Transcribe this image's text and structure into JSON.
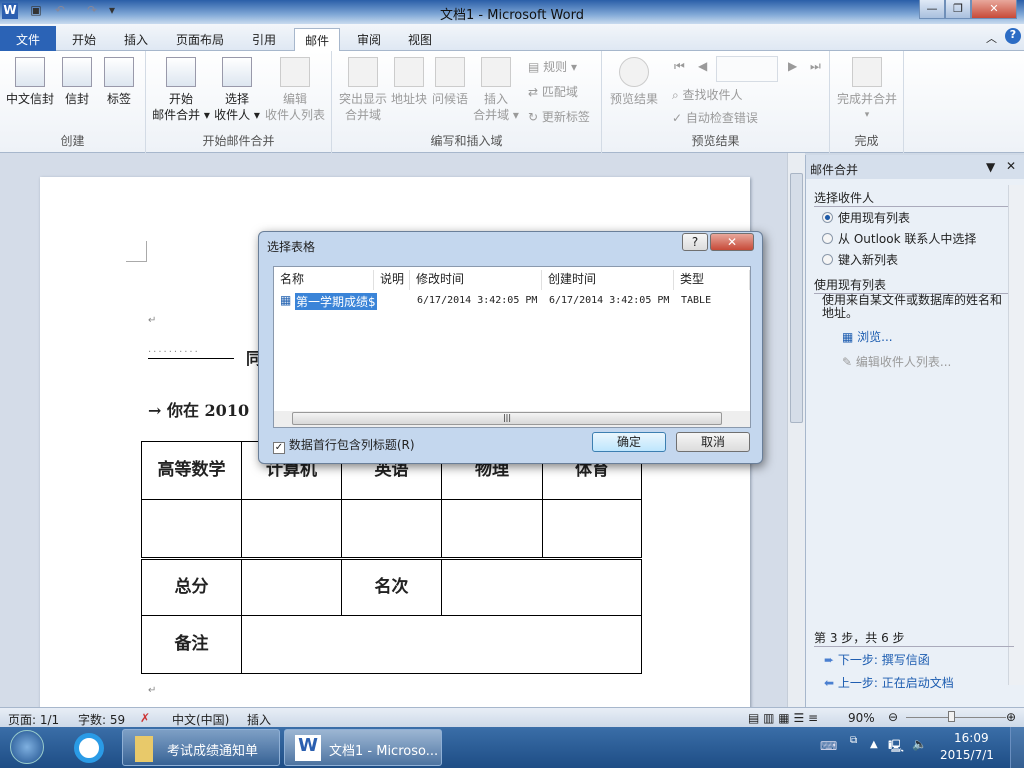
{
  "window": {
    "title": "文档1 - Microsoft Word",
    "controls": [
      "—",
      "❐",
      "✕"
    ]
  },
  "tabs": [
    "文件",
    "开始",
    "插入",
    "页面布局",
    "引用",
    "邮件",
    "审阅",
    "视图"
  ],
  "ribbon": {
    "create": {
      "label": "创建",
      "buttons": [
        "中文信封",
        "信封",
        "标签"
      ]
    },
    "start": {
      "label": "开始邮件合并",
      "b1": [
        "开始",
        "邮件合并 ▾"
      ],
      "b2": [
        "选择",
        "收件人 ▾"
      ],
      "b3": [
        "编辑",
        "收件人列表"
      ]
    },
    "write": {
      "label": "编写和插入域",
      "b1": [
        "突出显示",
        "合并域"
      ],
      "b2": "地址块",
      "b3": "问候语",
      "b4": [
        "插入",
        "合并域 ▾"
      ],
      "small": [
        "规则 ▾",
        "匹配域",
        "更新标签"
      ]
    },
    "preview": {
      "label": "预览结果",
      "big": "预览结果",
      "small": [
        "查找收件人",
        "自动检查错误"
      ]
    },
    "finish": {
      "label": "完成",
      "big": "完成并合并",
      "arrow": "▾"
    }
  },
  "document": {
    "line1": "同",
    "line2": "→ 你在 2010",
    "headers": [
      "高等数学",
      "计算机",
      "英语",
      "物理",
      "体育"
    ],
    "total": "总分",
    "rank": "名次",
    "note": "备注",
    "para": "↵"
  },
  "dialog": {
    "title": "选择表格",
    "help": "?",
    "close": "✕",
    "columns": [
      "名称",
      "说明",
      "修改时间",
      "创建时间",
      "类型"
    ],
    "rows": [
      {
        "name": "第一学期成绩$",
        "desc": "",
        "modified": "6/17/2014 3:42:05 PM",
        "created": "6/17/2014 3:42:05 PM",
        "type": "TABLE"
      }
    ],
    "checkbox": "数据首行包含列标题(R)",
    "checked": true,
    "ok": "确定",
    "cancel": "取消"
  },
  "pane": {
    "title": "邮件合并",
    "section1": "选择收件人",
    "options": [
      "使用现有列表",
      "从 Outlook 联系人中选择",
      "键入新列表"
    ],
    "selected": 0,
    "section2": "使用现有列表",
    "desc": "使用来自某文件或数据库的姓名和地址。",
    "browse": "浏览...",
    "edit": "编辑收件人列表...",
    "step": "第 3 步，共 6 步",
    "next": "下一步: 撰写信函",
    "prev": "上一步: 正在启动文档"
  },
  "status": {
    "page": "页面: 1/1",
    "words": "字数: 59",
    "lang": "中文(中国)",
    "mode": "插入",
    "zoom": "90%",
    "zoom_percent": 90
  },
  "taskbar": {
    "items": [
      "考试成绩通知单",
      "文档1 - Microso..."
    ],
    "time": "16:09",
    "date": "2015/7/1"
  }
}
